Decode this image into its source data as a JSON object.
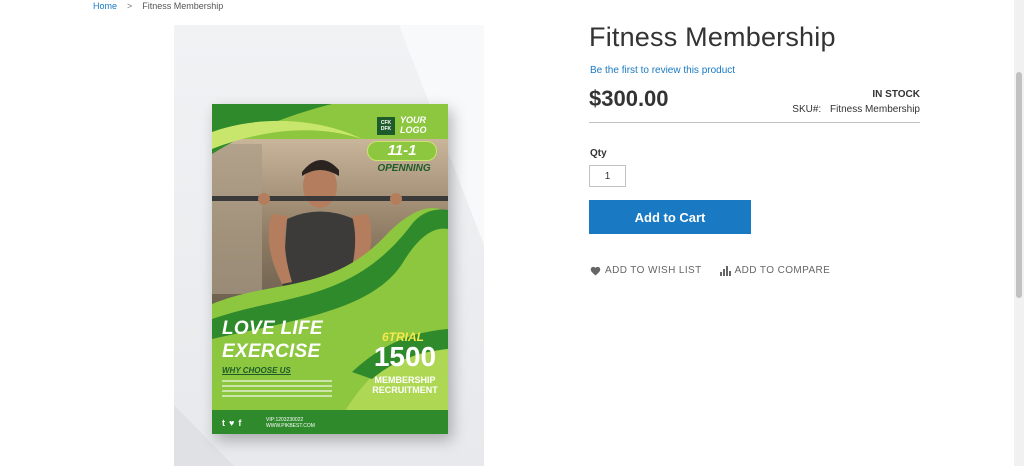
{
  "breadcrumb": {
    "home": "Home",
    "separator": ">",
    "current": "Fitness Membership"
  },
  "product": {
    "title": "Fitness Membership",
    "review_link": "Be the first to review this product",
    "price": "$300.00",
    "stock": "IN STOCK",
    "sku_label": "SKU#:",
    "sku_value": "Fitness Membership",
    "qty_label": "Qty",
    "qty_value": "1",
    "add_to_cart": "Add to Cart",
    "wish_list": "ADD TO WISH LIST",
    "compare": "ADD TO COMPARE"
  },
  "poster": {
    "logo_mark": "CFK DFK",
    "logo_text": "YOUR LOGO",
    "badge_top": "11-1",
    "badge_sub": "OPENNING",
    "headline_1": "LOVE LIFE",
    "headline_2": "EXERCISE",
    "why": "WHY CHOOSE US",
    "trial": "6TRIAL",
    "big_number": "1500",
    "recruit_1": "MEMBERSHIP",
    "recruit_2": "RECRUITMENT",
    "social": "t♥f",
    "contact_1": "VIP:1203230022",
    "contact_2": "WWW.PIKBEST.COM"
  },
  "colors": {
    "accent": "#1979c3",
    "poster_green": "#8dc63f",
    "poster_dark_green": "#1d5b2a"
  },
  "icons": {
    "wish": "heart-icon",
    "compare": "bar-chart-icon"
  }
}
